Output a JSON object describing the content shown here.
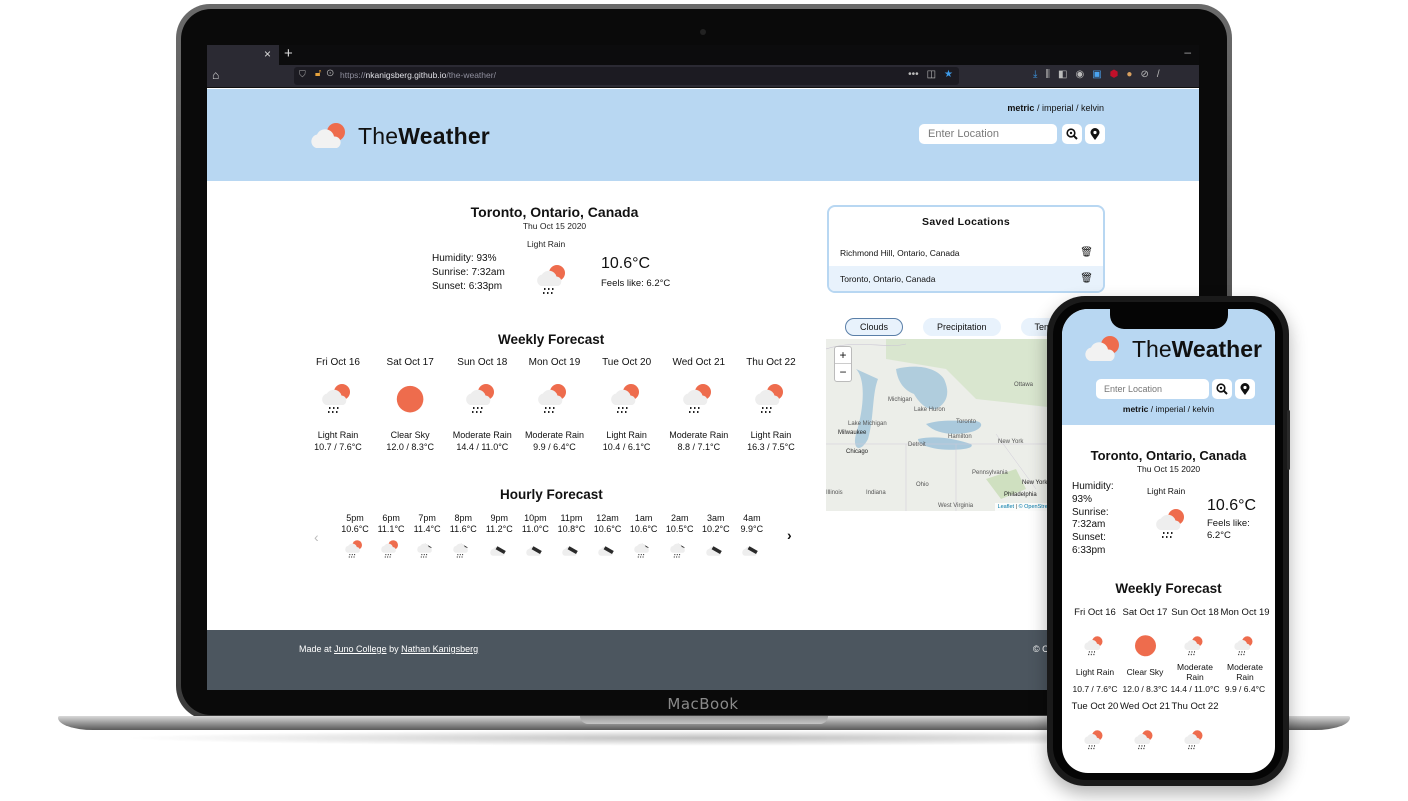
{
  "device_label": "MacBook",
  "browser": {
    "tab_close": "×",
    "new_tab": "+",
    "minimize": "–",
    "url_prefix": "https://",
    "url_domain": "nkanigsberg.github.io",
    "url_path": "/the-weather/",
    "page_actions": "•••",
    "toolbar_badge": "1"
  },
  "site": {
    "brand_regular": "The",
    "brand_bold": "Weather",
    "units": {
      "active": "metric",
      "sep": " / ",
      "options": [
        "imperial",
        "kelvin"
      ]
    },
    "search": {
      "placeholder": "Enter Location",
      "value": ""
    },
    "colors": {
      "header_bg": "#b8d7f2",
      "sun": "#ee6c4d",
      "footer_bg": "#4c565f"
    },
    "current": {
      "location": "Toronto, Ontario, Canada",
      "date": "Thu Oct 15 2020",
      "description": "Light Rain",
      "humidity": "Humidity: 93%",
      "sunrise": "Sunrise: 7:32am",
      "sunset": "Sunset: 6:33pm",
      "temp": "10.6°C",
      "feels_like": "Feels like: 6.2°C",
      "icon": "rain-sun-icon"
    },
    "weekly": {
      "title": "Weekly Forecast",
      "days": [
        {
          "name": "Fri Oct 16",
          "icon": "rain-sun",
          "desc": "Light Rain",
          "temp": "10.7 / 7.6°C"
        },
        {
          "name": "Sat Oct 17",
          "icon": "sun",
          "desc": "Clear Sky",
          "temp": "12.0 / 8.3°C"
        },
        {
          "name": "Sun Oct 18",
          "icon": "rain-sun",
          "desc": "Moderate Rain",
          "temp": "14.4 / 11.0°C"
        },
        {
          "name": "Mon Oct 19",
          "icon": "rain-sun",
          "desc": "Moderate Rain",
          "temp": "9.9 / 6.4°C"
        },
        {
          "name": "Tue Oct 20",
          "icon": "rain-sun",
          "desc": "Light Rain",
          "temp": "10.4 / 6.1°C"
        },
        {
          "name": "Wed Oct 21",
          "icon": "rain-sun",
          "desc": "Moderate Rain",
          "temp": "8.8 / 7.1°C"
        },
        {
          "name": "Thu Oct 22",
          "icon": "rain-sun",
          "desc": "Light Rain",
          "temp": "16.3 / 7.5°C"
        }
      ]
    },
    "hourly": {
      "title": "Hourly Forecast",
      "prev": "‹",
      "next": "›",
      "hours": [
        {
          "time": "5pm",
          "temp": "10.6°C",
          "icon": "rain-sun"
        },
        {
          "time": "6pm",
          "temp": "11.1°C",
          "icon": "rain-sun"
        },
        {
          "time": "7pm",
          "temp": "11.4°C",
          "icon": "rain-moon"
        },
        {
          "time": "8pm",
          "temp": "11.6°C",
          "icon": "rain-moon"
        },
        {
          "time": "9pm",
          "temp": "11.2°C",
          "icon": "cloud-moon"
        },
        {
          "time": "10pm",
          "temp": "11.0°C",
          "icon": "cloud-moon"
        },
        {
          "time": "11pm",
          "temp": "10.8°C",
          "icon": "cloud-moon"
        },
        {
          "time": "12am",
          "temp": "10.6°C",
          "icon": "cloud-moon"
        },
        {
          "time": "1am",
          "temp": "10.6°C",
          "icon": "rain-moon"
        },
        {
          "time": "2am",
          "temp": "10.5°C",
          "icon": "rain-moon"
        },
        {
          "time": "3am",
          "temp": "10.2°C",
          "icon": "cloud-moon"
        },
        {
          "time": "4am",
          "temp": "9.9°C",
          "icon": "cloud-moon"
        }
      ]
    },
    "saved": {
      "title": "Saved Locations",
      "items": [
        {
          "label": "Richmond Hill, Ontario, Canada",
          "selected": false
        },
        {
          "label": "Toronto, Ontario, Canada",
          "selected": true
        }
      ]
    },
    "map": {
      "tabs": [
        {
          "label": "Clouds",
          "active": true
        },
        {
          "label": "Precipitation",
          "active": false
        },
        {
          "label": "Temperature",
          "active": false
        }
      ],
      "zoom_in": "+",
      "zoom_out": "−",
      "labels": [
        "Ottawa",
        "Michigan",
        "Lake Huron",
        "Toronto",
        "Lake Michigan",
        "Milwaukee",
        "Hamilton",
        "Detroit",
        "New York",
        "Chicago",
        "Pennsylvania",
        "Ohio",
        "Indiana",
        "Illinois",
        "New York",
        "Philadelphia",
        "West Virginia"
      ],
      "attribution_leaflet": "Leaflet",
      "attribution_osm": "© OpenStreetMap"
    },
    "footer": {
      "made_at": "Made at ",
      "college": "Juno College",
      "by": " by ",
      "author": "Nathan Kanigsberg",
      "copyright": "© C"
    }
  },
  "phone": {
    "current": {
      "humidity_label": "Humidity:",
      "humidity_value": "93%",
      "sunrise_label": "Sunrise:",
      "sunrise_value": "7:32am",
      "sunset_label": "Sunset:",
      "sunset_value": "6:33pm",
      "feels_label": "Feels like:",
      "feels_value": "6.2°C"
    }
  }
}
